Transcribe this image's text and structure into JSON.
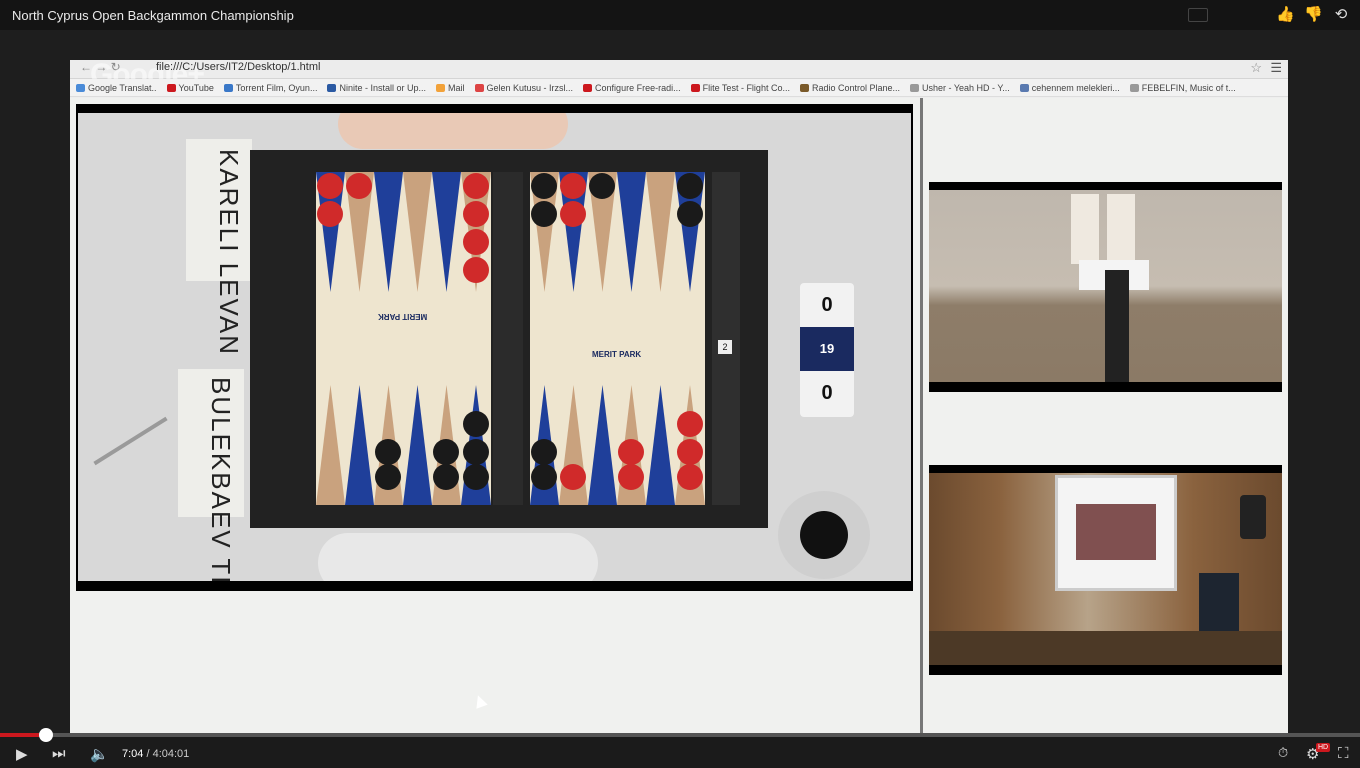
{
  "video": {
    "title": "North Cyprus Open Backgammon Championship",
    "current_time": "7:04",
    "duration": "4:04:01",
    "progress_fraction": 0.029,
    "hd_badge": "HD"
  },
  "browser": {
    "url": "file:///C:/Users/IT2/Desktop/1.html",
    "overlay": "Google+",
    "bookmarks": [
      {
        "label": "Google Translat..",
        "color": "#4a8bd8"
      },
      {
        "label": "YouTube",
        "color": "#cc181e"
      },
      {
        "label": "Torrent Film, Oyun...",
        "color": "#3a78c8"
      },
      {
        "label": "Ninite - Install or Up...",
        "color": "#2b5aa3"
      },
      {
        "label": "Mail",
        "color": "#f2a23a"
      },
      {
        "label": "Gelen Kutusu - Irzsl...",
        "color": "#d44"
      },
      {
        "label": "Configure Free-radi...",
        "color": "#cc181e"
      },
      {
        "label": "Flite Test - Flight Co...",
        "color": "#cc181e"
      },
      {
        "label": "Radio Control Plane...",
        "color": "#7a5a2a"
      },
      {
        "label": "Usher - Yeah HD - Y...",
        "color": "#999"
      },
      {
        "label": "cehennem melekleri...",
        "color": "#5a7ab0"
      },
      {
        "label": "FEBELFIN, Music of t...",
        "color": "#999"
      }
    ]
  },
  "stream": {
    "player1_card": "KARELI LEVAN",
    "player2_card": "BULEKBAEV TIMUR",
    "cube_scores": [
      "0",
      "19",
      "19",
      "0"
    ],
    "board_brand": "MERIT PARK",
    "die_value": "2"
  }
}
